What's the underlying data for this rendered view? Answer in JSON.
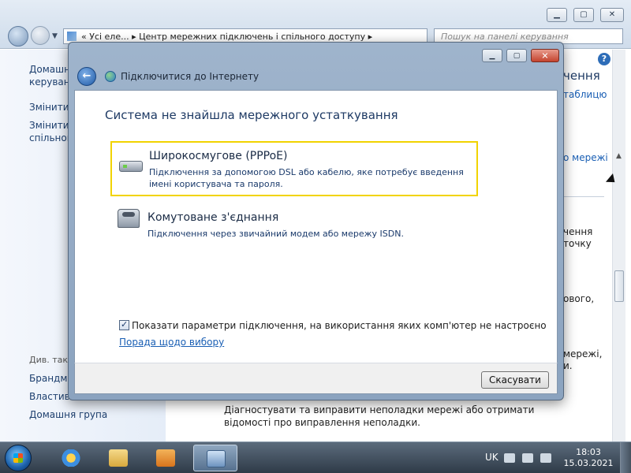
{
  "background": {
    "address_parts": [
      "«",
      "Усі еле...",
      "▸",
      "Центр мережних підключень і спільного доступу",
      "▸"
    ],
    "search_placeholder": "Пошук на панелі керування",
    "sidebar": {
      "links": [
        "Домашній",
        "керуван",
        "Змінити",
        "Змінити д",
        "спільног"
      ],
      "see_also_heading": "Див. також",
      "bottom_links": [
        "Брандмауер",
        "Властивості",
        "Домашня група"
      ]
    },
    "main": {
      "heading_fragment": "чення",
      "link_fragment": "таблицю",
      "link_fragment_2": "о мережі",
      "text_fragments": [
        "чення",
        "точку",
        "ового,",
        "мережі,",
        "и."
      ],
      "bottom_text": "Діагностувати та виправити неполадки мережі або отримати відомості про виправлення неполадки."
    }
  },
  "dialog": {
    "title": "Підключитися до Інтернету",
    "heading": "Система не знайшла мережного устаткування",
    "options": [
      {
        "title": "Широкосмугове (PPPoE)",
        "description": "Підключення за допомогою DSL або кабелю, яке потребує введення імені користувача та пароля.",
        "icon": "broadband-modem-icon",
        "selected": true
      },
      {
        "title": "Комутоване з'єднання",
        "description": "Підключення через звичайний модем або мережу ISDN.",
        "icon": "dialup-modem-icon",
        "selected": false
      }
    ],
    "checkbox": {
      "label": "Показати параметри підключення, на використання яких комп'ютер не настроєно",
      "checked": true
    },
    "help_link": "Порада щодо вибору",
    "cancel_label": "Скасувати"
  },
  "taskbar": {
    "language": "UK",
    "time": "18:03",
    "date": "15.03.2021",
    "apps": [
      "internet-explorer-icon",
      "windows-explorer-icon",
      "media-player-icon",
      "network-center-icon"
    ]
  },
  "colors": {
    "selection_border": "#f1d300",
    "link": "#1a5fb4",
    "heading": "#1e3a64"
  }
}
